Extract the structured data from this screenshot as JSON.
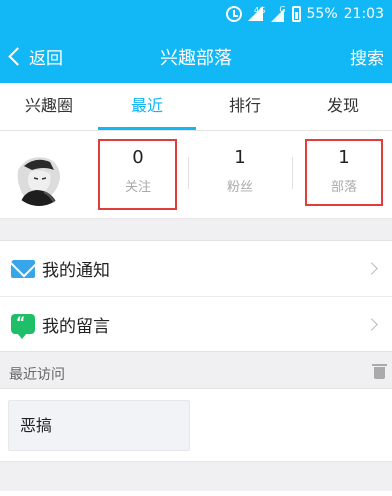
{
  "status_bar": {
    "battery": "55%",
    "time": "21:03",
    "network": "4G",
    "network2": "G",
    "icons": [
      "alarm-icon",
      "wifi-signal-icon",
      "cell-signal-icon",
      "battery-icon"
    ]
  },
  "nav": {
    "back_label": "返回",
    "title": "兴趣部落",
    "search_label": "搜索"
  },
  "tabs": [
    {
      "label": "兴趣圈",
      "active": false
    },
    {
      "label": "最近",
      "active": true
    },
    {
      "label": "排行",
      "active": false
    },
    {
      "label": "发现",
      "active": false
    }
  ],
  "profile": {
    "stats": [
      {
        "value": "0",
        "label": "关注"
      },
      {
        "value": "1",
        "label": "粉丝"
      },
      {
        "value": "1",
        "label": "部落"
      }
    ]
  },
  "menu": [
    {
      "label": "我的通知",
      "icon": "mail-icon"
    },
    {
      "label": "我的留言",
      "icon": "message-icon"
    }
  ],
  "recent": {
    "title": "最近访问",
    "items": [
      {
        "label": "恶搞"
      }
    ]
  },
  "colors": {
    "accent": "#12b7f5",
    "highlight_box": "#e03c3c",
    "mail_icon": "#36a5ea",
    "message_icon": "#1fbe69"
  }
}
